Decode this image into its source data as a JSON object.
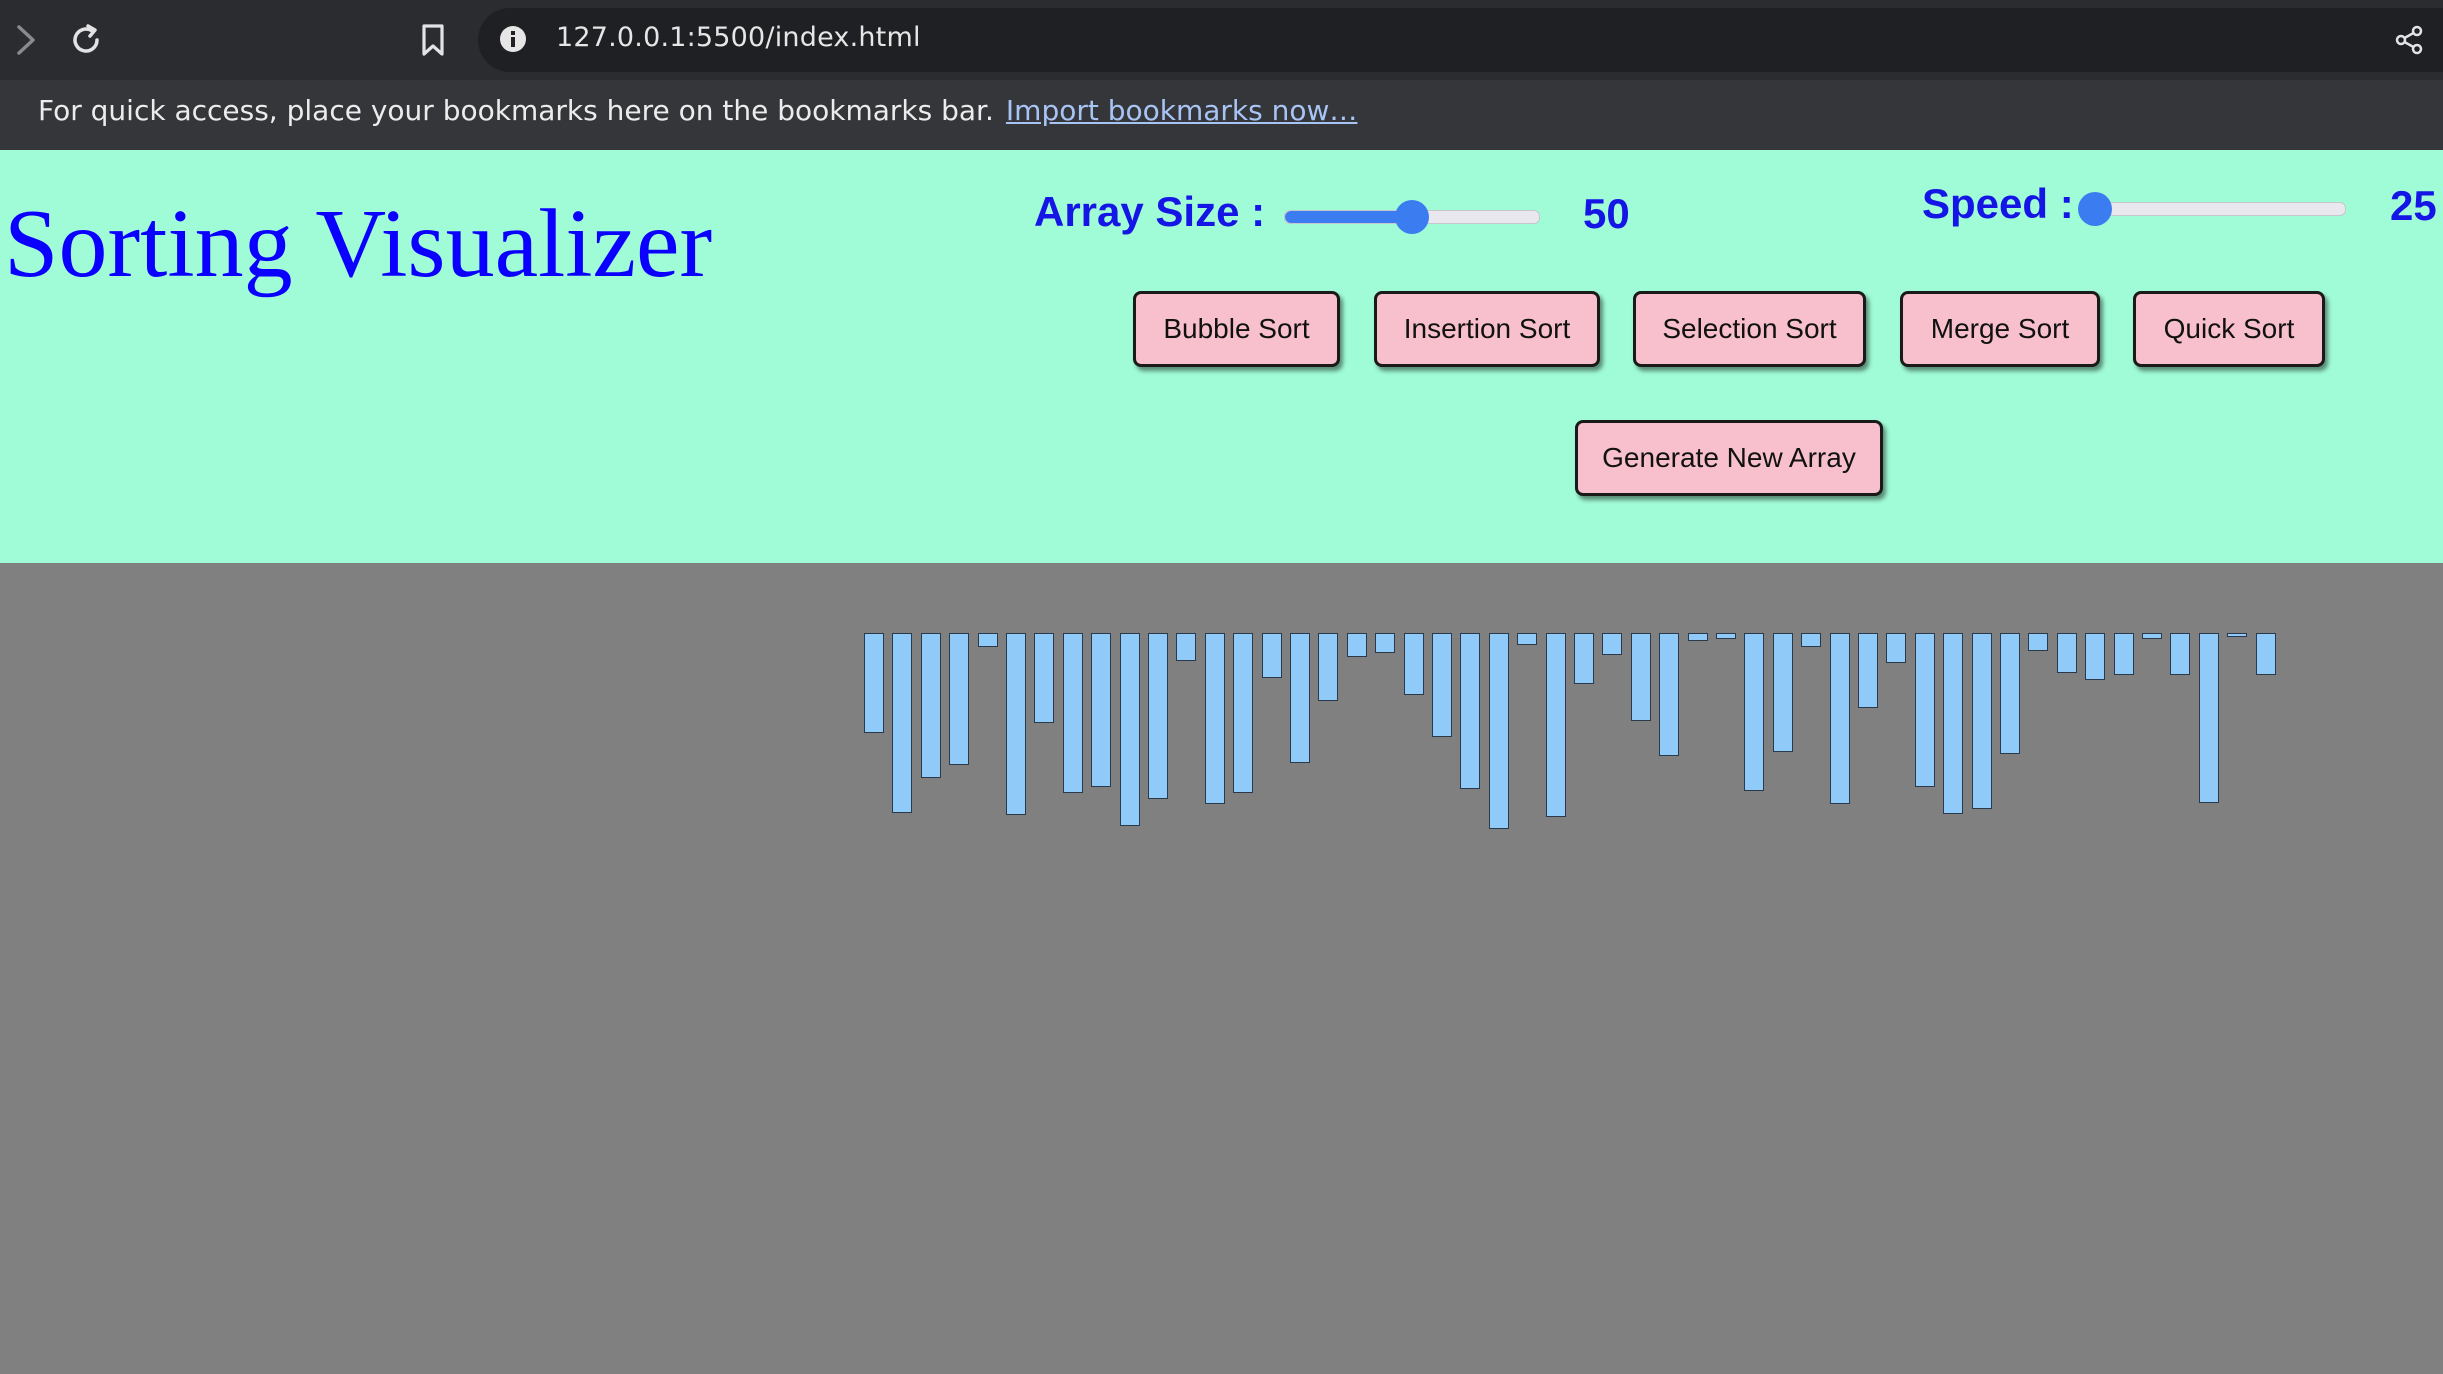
{
  "browser": {
    "url": "127.0.0.1:5500/index.html",
    "bookmarks_prompt": "For quick access, place your bookmarks here on the bookmarks bar.",
    "import_link": "Import bookmarks now…"
  },
  "header": {
    "title": "Sorting Visualizer",
    "array_size": {
      "label": "Array Size :",
      "value": "50",
      "level": 0.5
    },
    "speed": {
      "label": "Speed :",
      "value": "25",
      "level": 0.0
    }
  },
  "buttons": {
    "bubble": "Bubble Sort",
    "insertion": "Insertion Sort",
    "selection": "Selection Sort",
    "merge": "Merge Sort",
    "quick": "Quick Sort",
    "generate": "Generate New Array"
  },
  "colors": {
    "header_bg": "#a0fcd6",
    "title": "#0b00ff",
    "accent": "#3b7cf0",
    "button_bg": "#f7c0cc",
    "bar": "#90caf9",
    "area_bg": "#808080"
  },
  "array": {
    "bar_values": [
      100,
      180,
      145,
      132,
      14,
      182,
      90,
      160,
      154,
      193,
      166,
      28,
      171,
      160,
      45,
      130,
      68,
      24,
      20,
      62,
      104,
      156,
      196,
      12,
      184,
      51,
      22,
      88,
      123,
      8,
      6,
      158,
      119,
      14,
      171,
      75,
      30,
      154,
      181,
      176,
      121,
      18,
      40,
      47,
      42,
      6,
      42,
      170,
      4,
      42
    ]
  }
}
